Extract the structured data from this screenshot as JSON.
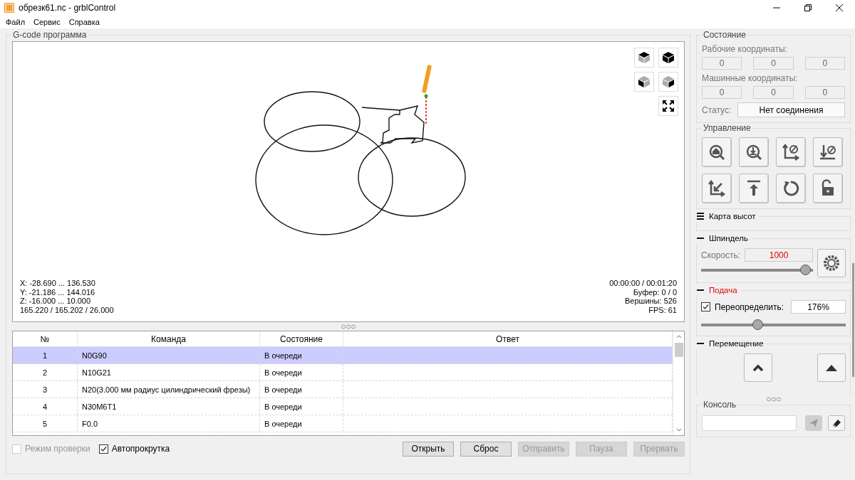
{
  "window": {
    "title": "обрезк61.nc - grblControl"
  },
  "menu": [
    "Файл",
    "Сервис",
    "Справка"
  ],
  "gcode_panel": {
    "title": "G-code программа",
    "info_left": [
      "X: -28.690 ... 136.530",
      "Y: -21.186 ... 144.016",
      "Z: -16.000 ... 10.000",
      "165.220 / 165.202 / 26.000"
    ],
    "info_right": [
      "00:00:00 / 00:01:20",
      "Буфер: 0 / 0",
      "Вершины: 526",
      "FPS: 61"
    ]
  },
  "table": {
    "columns": [
      "№",
      "Команда",
      "Состояние",
      "Ответ"
    ],
    "rows": [
      {
        "number": "1",
        "command": "N0G90",
        "state": "В очереди",
        "selected": true
      },
      {
        "number": "2",
        "command": "N10G21",
        "state": "В очереди",
        "selected": false
      },
      {
        "number": "3",
        "command": "N20(3.000 мм радиус цилиндрический фрезы)",
        "state": "В очереди",
        "selected": false
      },
      {
        "number": "4",
        "command": "N30M6T1",
        "state": "В очереди",
        "selected": false
      },
      {
        "number": "5",
        "command": "F0.0",
        "state": "В очереди",
        "selected": false
      }
    ]
  },
  "options": [
    {
      "label": "Режим проверки",
      "checked": false,
      "disabled": true
    },
    {
      "label": "Автопрокрутка",
      "checked": true,
      "disabled": false
    }
  ],
  "buttons": [
    {
      "label": "Открыть",
      "disabled": false
    },
    {
      "label": "Сброс",
      "disabled": false
    },
    {
      "label": "Отправить",
      "disabled": true
    },
    {
      "label": "Пауза",
      "disabled": true
    },
    {
      "label": "Прервать",
      "disabled": true
    }
  ],
  "state_panel": {
    "title": "Состояние",
    "work_label": "Рабочие координаты:",
    "work": [
      "0",
      "0",
      "0"
    ],
    "machine_label": "Машинные координаты:",
    "machine": [
      "0",
      "0",
      "0"
    ],
    "status_label": "Статус:",
    "status": "Нет соединения"
  },
  "control_panel": {
    "title": "Управление"
  },
  "heightmap": {
    "title": "Карта высот",
    "expanded": false
  },
  "spindle": {
    "title": "Шпиндель",
    "expanded": true,
    "speed_label": "Скорость:",
    "speed": "1000",
    "level": 0.97
  },
  "feed": {
    "title": "Подача",
    "expanded": true,
    "override_label": "Переопределить:",
    "override_checked": true,
    "value": "176%",
    "level": 0.38
  },
  "jog": {
    "title": "Перемещение",
    "expanded": true
  },
  "console": {
    "title": "Консоль"
  }
}
